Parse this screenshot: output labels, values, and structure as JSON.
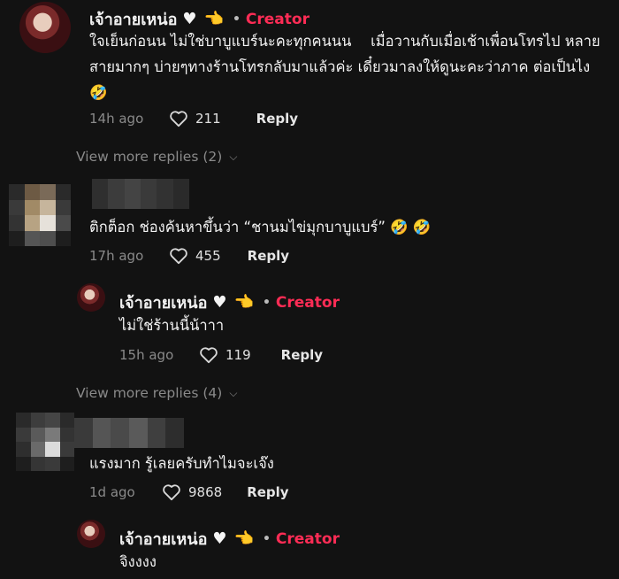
{
  "comments": [
    {
      "author": "เจ้าอายเหน่อ",
      "creator_badge": "Creator",
      "text": "ใจเย็นก่อนน ไม่ใช่บาบูแบร์นะคะทุกคนนน  เมื่อวานกับเมื่อเช้าเพื่อนโทรไป หลายสายมากๆ บ่ายๆทางร้านโทรกลับมาแล้วค่ะ เดี๋ยวมาลงให้ดูนะคะว่าภาค ต่อเป็นไง 🤣",
      "time": "14h ago",
      "likes": "211",
      "reply_label": "Reply",
      "view_more": "View more replies (2)"
    },
    {
      "text": "ติกต็อก ช่องค้นหาขึ้นว่า “ชานมไข่มุกบาบูแบร์” 🤣 🤣",
      "time": "17h ago",
      "likes": "455",
      "reply_label": "Reply",
      "reply": {
        "author": "เจ้าอายเหน่อ",
        "creator_badge": "Creator",
        "text": "ไม่ใช่ร้านนี้น้าาา ",
        "time": "15h ago",
        "likes": "119",
        "reply_label": "Reply"
      },
      "view_more": "View more replies (4)"
    },
    {
      "text": "แรงมาก รู้เลยครับทำไมจะเจ๊ง",
      "time": "1d ago",
      "likes": "9868",
      "reply_label": "Reply",
      "reply": {
        "author": "เจ้าอายเหน่อ",
        "creator_badge": "Creator",
        "text": "จิงงงง"
      }
    }
  ],
  "icons": {
    "heart": "heart-icon",
    "hand": "pointing-hand-icon",
    "chevron": "chevron-down-icon"
  },
  "colors": {
    "creator": "#fe2c55",
    "background": "#121212",
    "muted": "#8a8a8a"
  }
}
